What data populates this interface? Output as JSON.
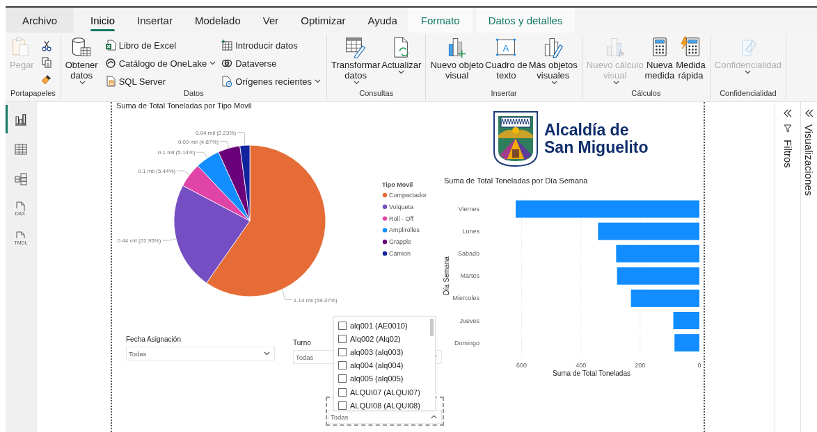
{
  "tabs": [
    {
      "label": "Archivo",
      "kind": "file",
      "selected": false
    },
    {
      "label": "Inicio",
      "kind": "standard",
      "selected": true
    },
    {
      "label": "Insertar",
      "kind": "standard",
      "selected": false
    },
    {
      "label": "Modelado",
      "kind": "standard",
      "selected": false
    },
    {
      "label": "Ver",
      "kind": "standard",
      "selected": false
    },
    {
      "label": "Optimizar",
      "kind": "standard",
      "selected": false
    },
    {
      "label": "Ayuda",
      "kind": "standard",
      "selected": false
    },
    {
      "label": "Formato",
      "kind": "contextual",
      "selected": false
    },
    {
      "label": "Datos y detalles",
      "kind": "contextual",
      "selected": false
    }
  ],
  "ribbon": {
    "groups": [
      {
        "label": "Portapapeles",
        "items": [
          {
            "kind": "large",
            "label": "Pegar",
            "disabled": true,
            "dropdown": false
          },
          {
            "kind": "tool"
          },
          {
            "kind": "tool"
          },
          {
            "kind": "tool"
          }
        ]
      },
      {
        "label": "Datos",
        "items": [
          {
            "kind": "large",
            "label": "Obtener\ndatos",
            "disabled": false,
            "dropdown": true
          },
          {
            "kind": "small",
            "label": "Libro de Excel",
            "dropdown": false
          },
          {
            "kind": "small",
            "label": "Catálogo de OneLake",
            "dropdown": true
          },
          {
            "kind": "small",
            "label": "SQL Server",
            "dropdown": false
          },
          {
            "kind": "small",
            "label": "Introducir datos",
            "dropdown": false
          },
          {
            "kind": "small",
            "label": "Dataverse",
            "dropdown": false
          },
          {
            "kind": "small",
            "label": "Orígenes recientes",
            "dropdown": true
          }
        ]
      },
      {
        "label": "Consultas",
        "items": [
          {
            "kind": "large",
            "label": "Transformar\ndatos",
            "disabled": false,
            "dropdown": true
          },
          {
            "kind": "large",
            "label": "Actualizar",
            "disabled": false,
            "dropdown": true
          }
        ]
      },
      {
        "label": "Insertar",
        "items": [
          {
            "kind": "large",
            "label": "Nuevo objeto\nvisual",
            "disabled": false,
            "dropdown": false
          },
          {
            "kind": "large",
            "label": "Cuadro de\ntexto",
            "disabled": false,
            "dropdown": false,
            "icon_text": "A"
          },
          {
            "kind": "large",
            "label": "Más objetos\nvisuales",
            "disabled": false,
            "dropdown": true
          }
        ]
      },
      {
        "label": "Cálculos",
        "items": [
          {
            "kind": "large",
            "label": "Nuevo cálculo\nvisual",
            "disabled": true,
            "dropdown": true,
            "icon_text": "fx"
          },
          {
            "kind": "large",
            "label": "Nueva\nmedida",
            "disabled": false,
            "dropdown": false
          },
          {
            "kind": "large",
            "label": "Medida\nrápida",
            "disabled": false,
            "dropdown": false
          }
        ]
      },
      {
        "label": "Confidencialidad",
        "items": [
          {
            "kind": "large",
            "label": "Confidencialidad",
            "disabled": true,
            "dropdown": true
          }
        ]
      }
    ]
  },
  "nav": {
    "items": [
      {
        "kind": "report",
        "selected": true
      },
      {
        "kind": "table",
        "selected": false
      },
      {
        "kind": "model",
        "selected": false
      },
      {
        "kind": "dax",
        "selected": false,
        "icon_text": "DAX"
      },
      {
        "kind": "tmdl",
        "selected": false,
        "icon_text": "TMDL"
      }
    ]
  },
  "page": {
    "visuals": [
      {
        "kind": "chart",
        "chart_data": {
          "type": "pie",
          "title": "Suma de Total Toneladas por Tipo Movil",
          "categories": [
            "Compactador",
            "Volqueta",
            "Roll - Off",
            "Amplirolles",
            "Grapple",
            "Camion"
          ],
          "values": [
            1.14,
            0.44,
            0.1,
            0.1,
            0.09,
            0.04
          ],
          "value_labels": [
            "1.14 mil (59.37%)",
            "0.44 mil (22.95%)",
            "0.1 mil (5.44%)",
            "0.1 mil (5.14%)",
            "0.09 mil (4.87%)",
            "0.04 mil (2.23%)"
          ],
          "legend": {
            "title": "Tipo Movil",
            "items": [
              {
                "color": "#e66c37"
              },
              {
                "color": "#744ec2"
              },
              {
                "color": "#e044a7"
              },
              {
                "color": "#118dff"
              },
              {
                "color": "#6b007b"
              },
              {
                "color": "#12239e"
              }
            ]
          }
        }
      },
      {
        "kind": "logo",
        "text": "Alcaldía de San Miguelito"
      },
      {
        "kind": "chart",
        "chart_data": {
          "type": "bar",
          "orientation": "horizontal",
          "title": "Suma de Total Toneladas por Día Semana",
          "xlabel": "Suma de Total Toneladas",
          "ylabel": "Día Semana",
          "categories": [
            "Viernes",
            "Lunes",
            "Sabado",
            "Martes",
            "Miercoles",
            "Jueves",
            "Domingo"
          ],
          "series": [
            {
              "color": "#118dff",
              "values": [
                620,
                342,
                281,
                278,
                231,
                88,
                84
              ]
            }
          ],
          "xlim": [
            620,
            0
          ],
          "xticks": [
            600,
            400,
            200,
            0
          ],
          "grid": true
        }
      }
    ],
    "slicers": [
      {
        "title": "Fecha Asignación",
        "value": "Todas",
        "expanded": false,
        "focused": false
      },
      {
        "title": "Turno",
        "value": "Todas",
        "expanded": false,
        "focused": false
      },
      {
        "value": "Todas",
        "expanded": true,
        "focused": true,
        "options": [
          {
            "label": "alq001 (AE0010)",
            "checked": false
          },
          {
            "label": "Alq002 (Alq02)",
            "checked": false
          },
          {
            "label": "alq003 (alq003)",
            "checked": false
          },
          {
            "label": "alq004 (alq004)",
            "checked": false
          },
          {
            "label": "alq005 (alq005)",
            "checked": false
          },
          {
            "label": "ALQUI07 (ALQUI07)",
            "checked": false
          },
          {
            "label": "ALQUI08 (ALQUI08)",
            "checked": false
          }
        ]
      }
    ]
  },
  "panes": [
    {
      "kind": "filters",
      "title": "Filtros"
    },
    {
      "kind": "visualizations",
      "title": "Visualizaciones"
    }
  ]
}
